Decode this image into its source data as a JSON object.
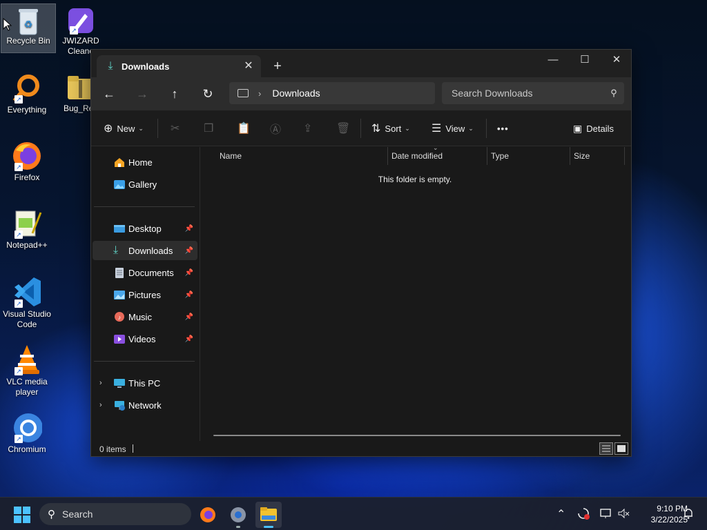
{
  "desktop": {
    "icons": [
      {
        "label": "Recycle Bin",
        "icon": "recycle-bin-icon"
      },
      {
        "label": "JWIZARD Cleane",
        "icon": "jwizard-icon"
      },
      {
        "label": "Everything",
        "icon": "everything-icon"
      },
      {
        "label": "Bug_Rep",
        "icon": "zip-folder-icon"
      },
      {
        "label": "Firefox",
        "icon": "firefox-icon"
      },
      {
        "label": "Notepad++",
        "icon": "notepadpp-icon"
      },
      {
        "label": "Visual Studio Code",
        "icon": "vscode-icon"
      },
      {
        "label": "VLC media player",
        "icon": "vlc-icon"
      },
      {
        "label": "Chromium",
        "icon": "chromium-icon"
      }
    ]
  },
  "window": {
    "tab_title": "Downloads",
    "address": {
      "crumb": "Downloads"
    },
    "search": {
      "placeholder": "Search Downloads"
    },
    "toolbar": {
      "new_label": "New",
      "sort_label": "Sort",
      "view_label": "View",
      "more_label": "•••",
      "details_label": "Details"
    },
    "sidebar": {
      "home": "Home",
      "gallery": "Gallery",
      "quick_access": [
        "Desktop",
        "Downloads",
        "Documents",
        "Pictures",
        "Music",
        "Videos"
      ],
      "active": "Downloads",
      "this_pc": "This PC",
      "network": "Network"
    },
    "columns": [
      "Name",
      "Date modified",
      "Type",
      "Size"
    ],
    "empty_message": "This folder is empty.",
    "status": {
      "items": "0 items"
    }
  },
  "taskbar": {
    "search_label": "Search",
    "time": "9:10 PM",
    "date": "3/22/2025"
  },
  "colors": {
    "accent": "#4cc2ff",
    "window_bg": "#191919",
    "download_teal": "#5fd0c4"
  }
}
